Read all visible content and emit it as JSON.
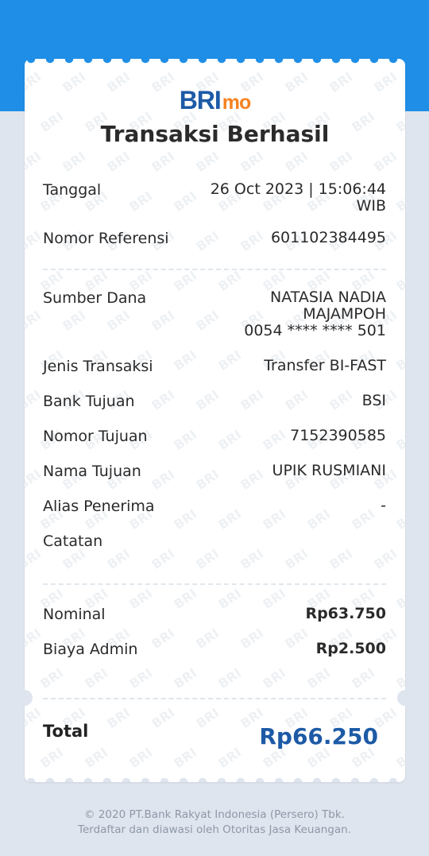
{
  "brand": {
    "logo_bri": "BRI",
    "logo_mo": "mo"
  },
  "title": "Transaksi Berhasil",
  "rows": {
    "tanggal": {
      "label": "Tanggal",
      "value_line1": "26 Oct 2023 | 15:06:44",
      "value_line2": "WIB"
    },
    "referensi": {
      "label": "Nomor Referensi",
      "value": "601102384495"
    },
    "sumber_dana": {
      "label": "Sumber Dana",
      "value_line1": "NATASIA NADIA",
      "value_line2": "MAJAMPOH",
      "value_line3": "0054 **** **** 501"
    },
    "jenis": {
      "label": "Jenis Transaksi",
      "value": "Transfer BI-FAST"
    },
    "bank": {
      "label": "Bank Tujuan",
      "value": "BSI"
    },
    "nomor_tujuan": {
      "label": "Nomor Tujuan",
      "value": "7152390585"
    },
    "nama_tujuan": {
      "label": "Nama Tujuan",
      "value": "UPIK RUSMIANI"
    },
    "alias": {
      "label": "Alias Penerima",
      "value": "-"
    },
    "catatan": {
      "label": "Catatan",
      "value": ""
    },
    "nominal": {
      "label": "Nominal",
      "value": "Rp63.750"
    },
    "biaya_admin": {
      "label": "Biaya Admin",
      "value": "Rp2.500"
    }
  },
  "total": {
    "label": "Total",
    "value": "Rp66.250"
  },
  "watermark": "BRI",
  "footer": {
    "line1": "© 2020 PT.Bank Rakyat Indonesia (Persero) Tbk.",
    "line2": "Terdaftar dan diawasi oleh Otoritas Jasa Keuangan."
  },
  "colors": {
    "header_blue": "#1f8ee6",
    "brand_blue": "#1d5aa6",
    "brand_orange": "#f58220",
    "background": "#dfe5ee"
  }
}
